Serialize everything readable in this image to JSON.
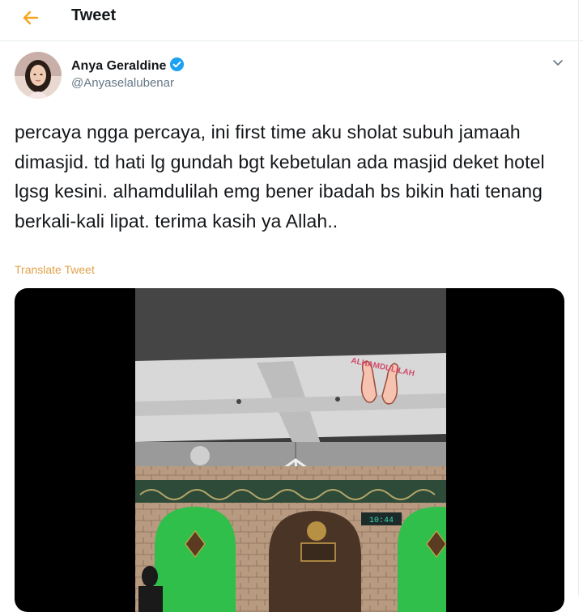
{
  "header": {
    "title": "Tweet",
    "back_icon": "arrow-left-icon",
    "accent_color": "#f5a623"
  },
  "author": {
    "name": "Anya Geraldine",
    "handle": "@Anyaselalubenar",
    "verified": true,
    "verified_color": "#1da1f2"
  },
  "tweet": {
    "text": "percaya ngga percaya, ini first time aku sholat subuh jamaah dimasjid. td hati lg gundah bgt kebetulan ada masjid deket hotel lgsg kesini. alhamdulilah emg bener ibadah bs bikin hati tenang berkali-kali lipat. terima kasih ya Allah..",
    "translate_label": "Translate Tweet",
    "translate_color": "#e0a24a"
  },
  "media": {
    "sticker_text": "ALHAMDULILAH",
    "sticker_icon": "praying-hands-icon",
    "clock_text": "10:44",
    "accent_green": "#2fbf4a"
  }
}
